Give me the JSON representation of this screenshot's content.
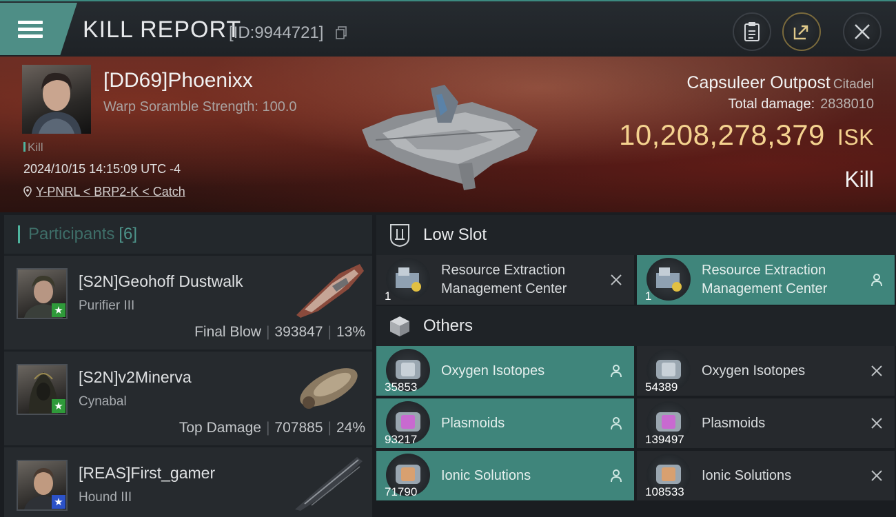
{
  "header": {
    "title": "KILL REPORT",
    "report_id": "[ID:9944721]"
  },
  "victim": {
    "pilot_name": "[DD69]Phoenixx",
    "warp_scramble": "Warp Soramble Strength: 100.0",
    "kill_tag": "Kill",
    "datetime": "2024/10/15 14:15:09 UTC -4",
    "location": "Y-PNRL < BRP2-K < Catch",
    "target_name": "Capsuleer Outpost",
    "target_class": "Citadel",
    "total_damage_label": "Total damage:",
    "total_damage": "2838010",
    "isk_value": "10,208,278,379",
    "isk_unit": "ISK",
    "result": "Kill"
  },
  "participants": {
    "title": "Participants",
    "count": "[6]",
    "rows": [
      {
        "name": "[S2N]Geohoff Dustwalk",
        "ship": "Purifier III",
        "role": "Final Blow",
        "damage": "393847",
        "percent": "13%",
        "badge": "star",
        "badge_color": "#2f9a3a"
      },
      {
        "name": "[S2N]v2Minerva",
        "ship": "Cynabal",
        "role": "Top Damage",
        "damage": "707885",
        "percent": "24%",
        "badge": "star",
        "badge_color": "#2f9a3a"
      },
      {
        "name": "[REAS]First_gamer",
        "ship": "Hound III",
        "badge": "star",
        "badge_color": "#2c52c8"
      }
    ]
  },
  "sections": {
    "low_slot": "Low Slot",
    "others": "Others"
  },
  "low_slot_items": [
    {
      "name_line1": "Resource Extraction",
      "name_line2": "Management Center",
      "qty": "1",
      "action": "close-icon",
      "highlight": false
    },
    {
      "name_line1": "Resource Extraction",
      "name_line2": "Management Center",
      "qty": "1",
      "action": "person-icon",
      "highlight": true
    }
  ],
  "other_items": [
    {
      "name": "Oxygen Isotopes",
      "qty": "35853",
      "action": "person-icon",
      "highlight": true
    },
    {
      "name": "Oxygen Isotopes",
      "qty": "54389",
      "action": "close-icon",
      "highlight": false
    },
    {
      "name": "Plasmoids",
      "qty": "93217",
      "action": "person-icon",
      "highlight": true
    },
    {
      "name": "Plasmoids",
      "qty": "139497",
      "action": "close-icon",
      "highlight": false
    },
    {
      "name": "Ionic Solutions",
      "qty": "71790",
      "action": "person-icon",
      "highlight": true
    },
    {
      "name": "Ionic Solutions",
      "qty": "108533",
      "action": "close-icon",
      "highlight": false
    }
  ],
  "colors": {
    "accent": "#4e8e86",
    "isk": "#f4d28f",
    "highlight_row": "#3f857b"
  }
}
